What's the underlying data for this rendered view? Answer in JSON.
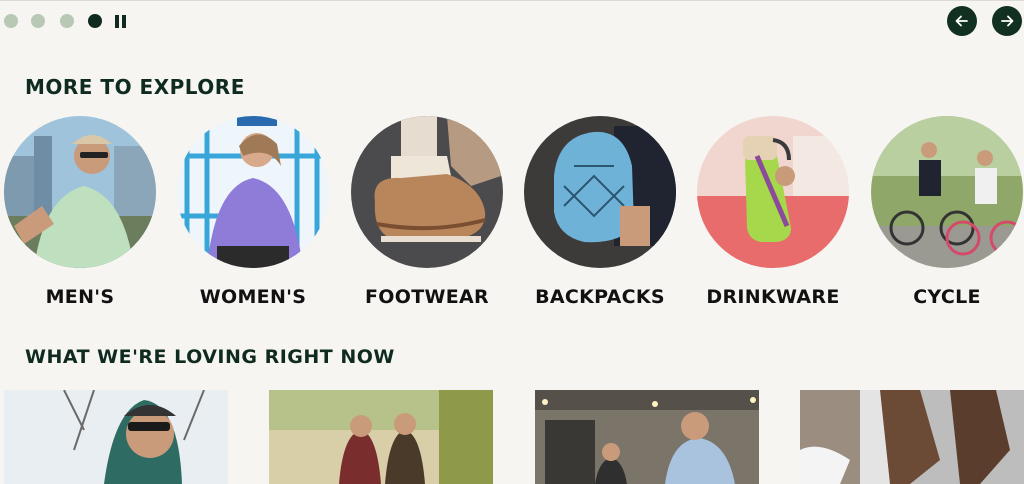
{
  "carousel": {
    "dots": [
      {
        "state": "inactive"
      },
      {
        "state": "inactive"
      },
      {
        "state": "inactive"
      },
      {
        "state": "active"
      }
    ],
    "pause_icon": "pause-icon",
    "prev_icon": "arrow-left-icon",
    "next_icon": "arrow-right-icon"
  },
  "sections": {
    "explore_title": "MORE TO EXPLORE",
    "loving_title": "WHAT WE'RE LOVING RIGHT NOW"
  },
  "categories": [
    {
      "label": "MEN'S"
    },
    {
      "label": "WOMEN'S"
    },
    {
      "label": "FOOTWEAR"
    },
    {
      "label": "BACKPACKS"
    },
    {
      "label": "DRINKWARE"
    },
    {
      "label": "CYCLE"
    }
  ],
  "colors": {
    "brand_dark": "#0f2b20",
    "dot_inactive": "#b9c8b5",
    "background": "#f7f5f2"
  }
}
